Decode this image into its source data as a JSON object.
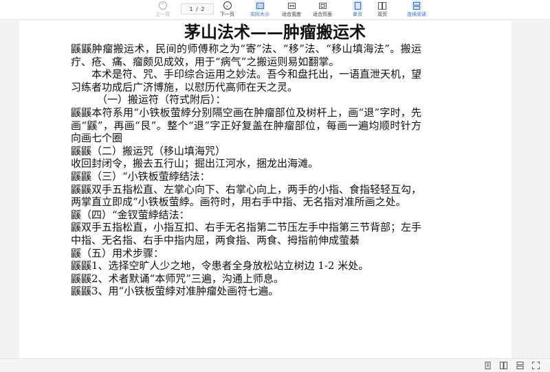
{
  "toolbar": {
    "prev_label": "上一页",
    "page_current": "1",
    "page_total": "/ 2",
    "next_label": "下一页",
    "actual_size_label": "实际大小",
    "fit_width_label": "适合宽度",
    "fit_page_label": "适合页面",
    "single_page_label": "单页",
    "double_page_label": "双页",
    "continuous_label": "连续阅读",
    "accent_color": "#2a6de0"
  },
  "document": {
    "title": "茅山法术——肿瘤搬运术",
    "paragraphs": [
      "鼷鼷肿瘤搬运术，民间的师傅称之为“寄”法、“移”法、“移山填海法”。搬运疔、疮、痛、瘤颇见成效，用于“病气”之搬运则易如翻掌。",
      "本术是符、咒、手印综合运用之妙法。吾今和盘托出，一语直泄天机，望习练者功成后广济博施，以慰历代高师在天之灵。",
      "（一）搬运符（符式附后）：",
      "鼷鼷本符系用“小铁板萤綍分别隔空画在肿瘤部位及树杆上，画“退”字时，先画“鼷”，再画“艮”。整个“退”字正好复盖在肿瘤部位，每画一遍均顺时针方向画七个圈",
      "鼷鼷（二）搬运咒（移山填海咒）",
      "收回封闭令，搬去五行山；掘出江河水，捆龙出海滩。",
      "鼷鼷（三）“小铁板萤綍结法：",
      "鼷鼷双手五指松直、左掌心向下、右掌心向上，两手的小指、食指轻轻互勾，两掌直立即成“小铁板萤綍。画符时，用右手中指、无名指对准所画之处。",
      "鼷（四）“金钗萤綍结法：",
      "鼷双手五指松直，小指互扣、右手无名指第二节压左手中指第三节背部；左手中指、无名指、右手中指内屈，两食指、两食、拇指前伸成萤綦",
      "鼷（五）用术步骤：",
      "鼷鼷1、选择空旷人少之地，令患者全身放松站立树边 1-2 米处。",
      "鼷鼷2、术者默诵“本师咒”三遍，沟通上师息。",
      "鼷鼷3、用“小铁板萤綍对准肿瘤处画符七遍。"
    ]
  }
}
